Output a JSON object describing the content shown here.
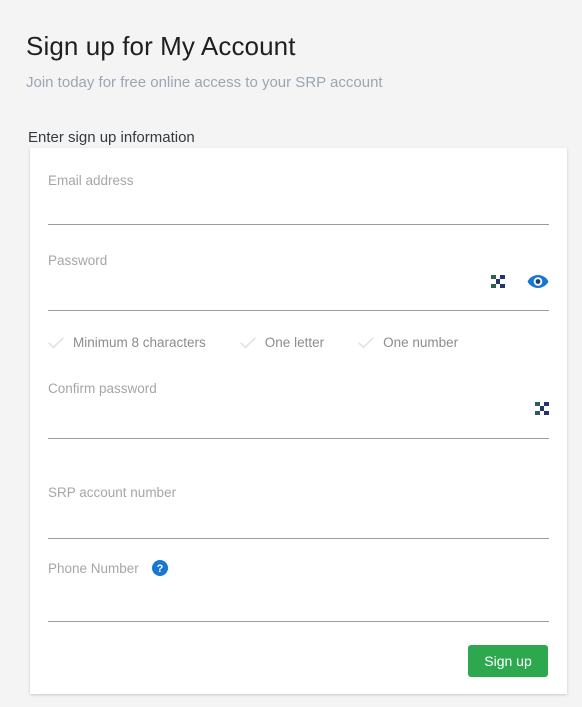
{
  "header": {
    "title": "Sign up for My Account",
    "subtitle": "Join today for free online access to your SRP account",
    "section_heading": "Enter sign up information"
  },
  "form": {
    "fields": [
      {
        "label": "Email address",
        "value": "",
        "placeholder": ""
      },
      {
        "label": "Password",
        "value": "",
        "placeholder": ""
      },
      {
        "label": "Confirm password",
        "value": "",
        "placeholder": ""
      },
      {
        "label": "SRP account number",
        "value": "",
        "placeholder": ""
      },
      {
        "label": "Phone Number",
        "value": "",
        "placeholder": ""
      }
    ],
    "password_requirements": [
      {
        "label": "Minimum 8 characters",
        "met": false,
        "icon": "check-icon"
      },
      {
        "label": "One letter",
        "met": false,
        "icon": "check-icon"
      },
      {
        "label": "One number",
        "met": false,
        "icon": "check-icon"
      }
    ],
    "icons": {
      "password_ibeam": "text-cursor-icon",
      "password_reveal": "eye-icon",
      "confirm_ibeam": "text-cursor-icon",
      "phone_help": "help-circle-icon"
    },
    "submit_label": "Sign up"
  },
  "colors": {
    "page_background": "#f4f4f4",
    "card_background": "#ffffff",
    "title": "#1f1f1f",
    "subtitle": "#9aa6b4",
    "label": "#a6a6a6",
    "underline": "#9b9b9b",
    "requirement_text": "#8c8c8c",
    "requirement_check": "#dfe3e8",
    "accent_blue": "#1877d2",
    "icon_dark": "#1f3b57",
    "submit_green": "#2ea84f",
    "submit_text": "#ffffff"
  }
}
